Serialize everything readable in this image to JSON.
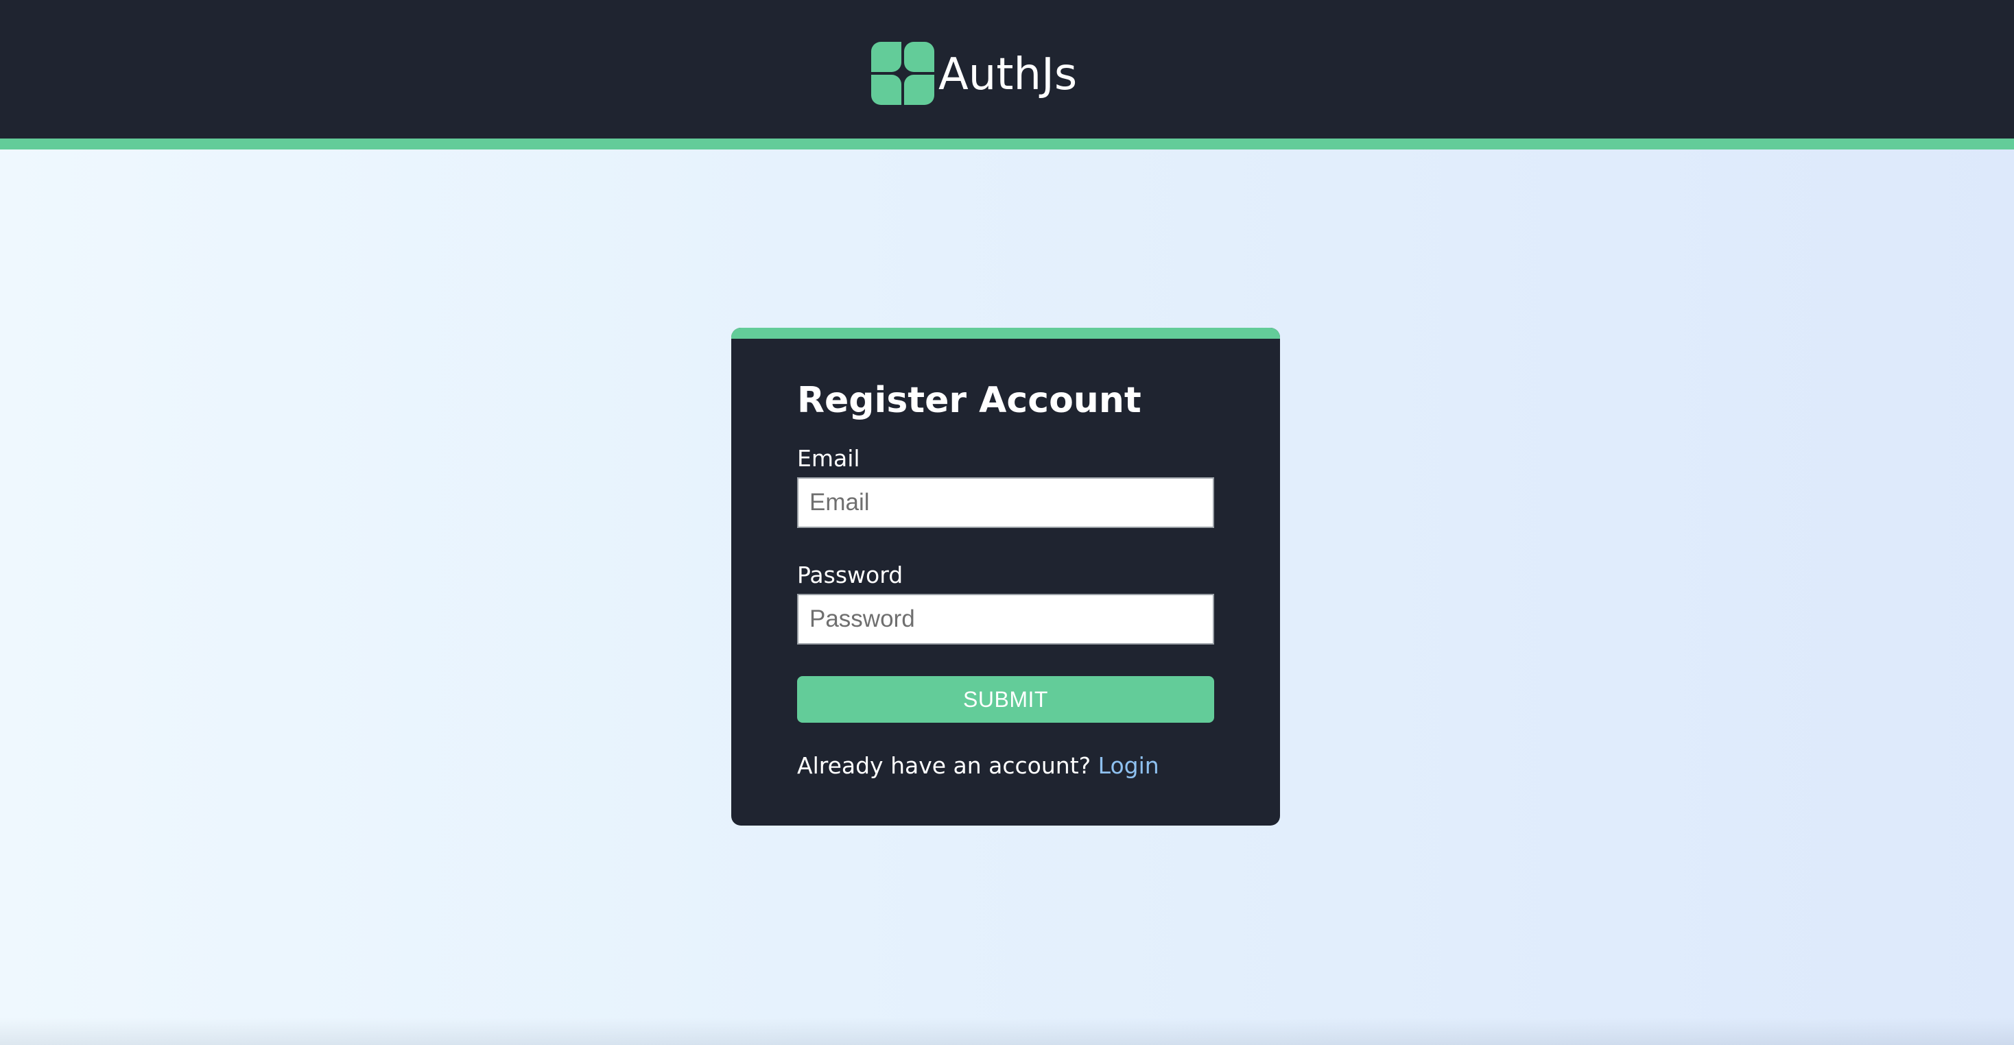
{
  "header": {
    "logo_icon": "clover-logo-icon",
    "brand_name": "AuthJs",
    "accent_color": "#63cc99",
    "background_color": "#1f2430"
  },
  "register_form": {
    "title": "Register Account",
    "email": {
      "label": "Email",
      "placeholder": "Email",
      "value": ""
    },
    "password": {
      "label": "Password",
      "placeholder": "Password",
      "value": ""
    },
    "submit_label": "SUBMIT",
    "footer_text": "Already have an account?",
    "login_link_label": "Login",
    "link_color": "#8fc1f0"
  }
}
